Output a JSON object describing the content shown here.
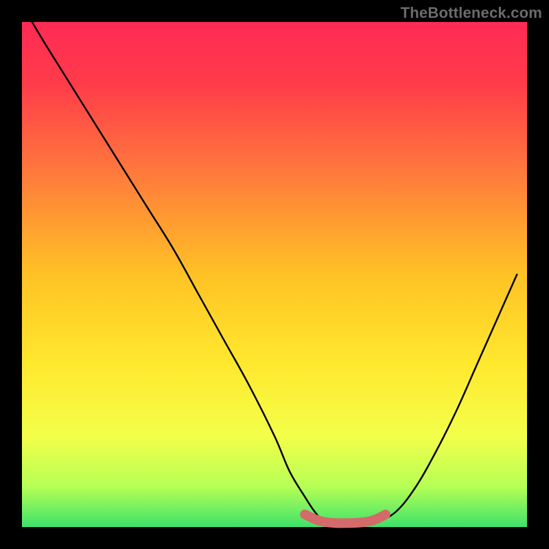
{
  "watermark": "TheBottleneck.com",
  "chart_data": {
    "type": "line",
    "title": "",
    "xlabel": "",
    "ylabel": "",
    "xlim": [
      0,
      100
    ],
    "ylim": [
      0,
      100
    ],
    "series": [
      {
        "name": "curve",
        "x": [
          2,
          5,
          10,
          15,
          20,
          25,
          30,
          35,
          40,
          45,
          50,
          53,
          56,
          58,
          60,
          63,
          66,
          70,
          74,
          78,
          82,
          86,
          90,
          94,
          98
        ],
        "y": [
          100,
          95,
          87,
          79,
          71,
          63,
          55,
          46,
          37,
          28,
          18,
          11,
          6,
          3,
          1,
          0.5,
          0.5,
          1,
          3,
          8,
          15,
          23,
          32,
          41,
          50
        ],
        "color": "#000000"
      },
      {
        "name": "marker-band",
        "x": [
          56,
          59,
          62,
          65,
          68,
          70,
          72
        ],
        "y": [
          2.5,
          1.2,
          0.8,
          0.8,
          1.0,
          1.5,
          2.5
        ],
        "color": "#d46a6a"
      }
    ],
    "background_gradient": {
      "top": "#ff2a55",
      "mid": "#ffd400",
      "bottom": "#3ee26a"
    }
  }
}
